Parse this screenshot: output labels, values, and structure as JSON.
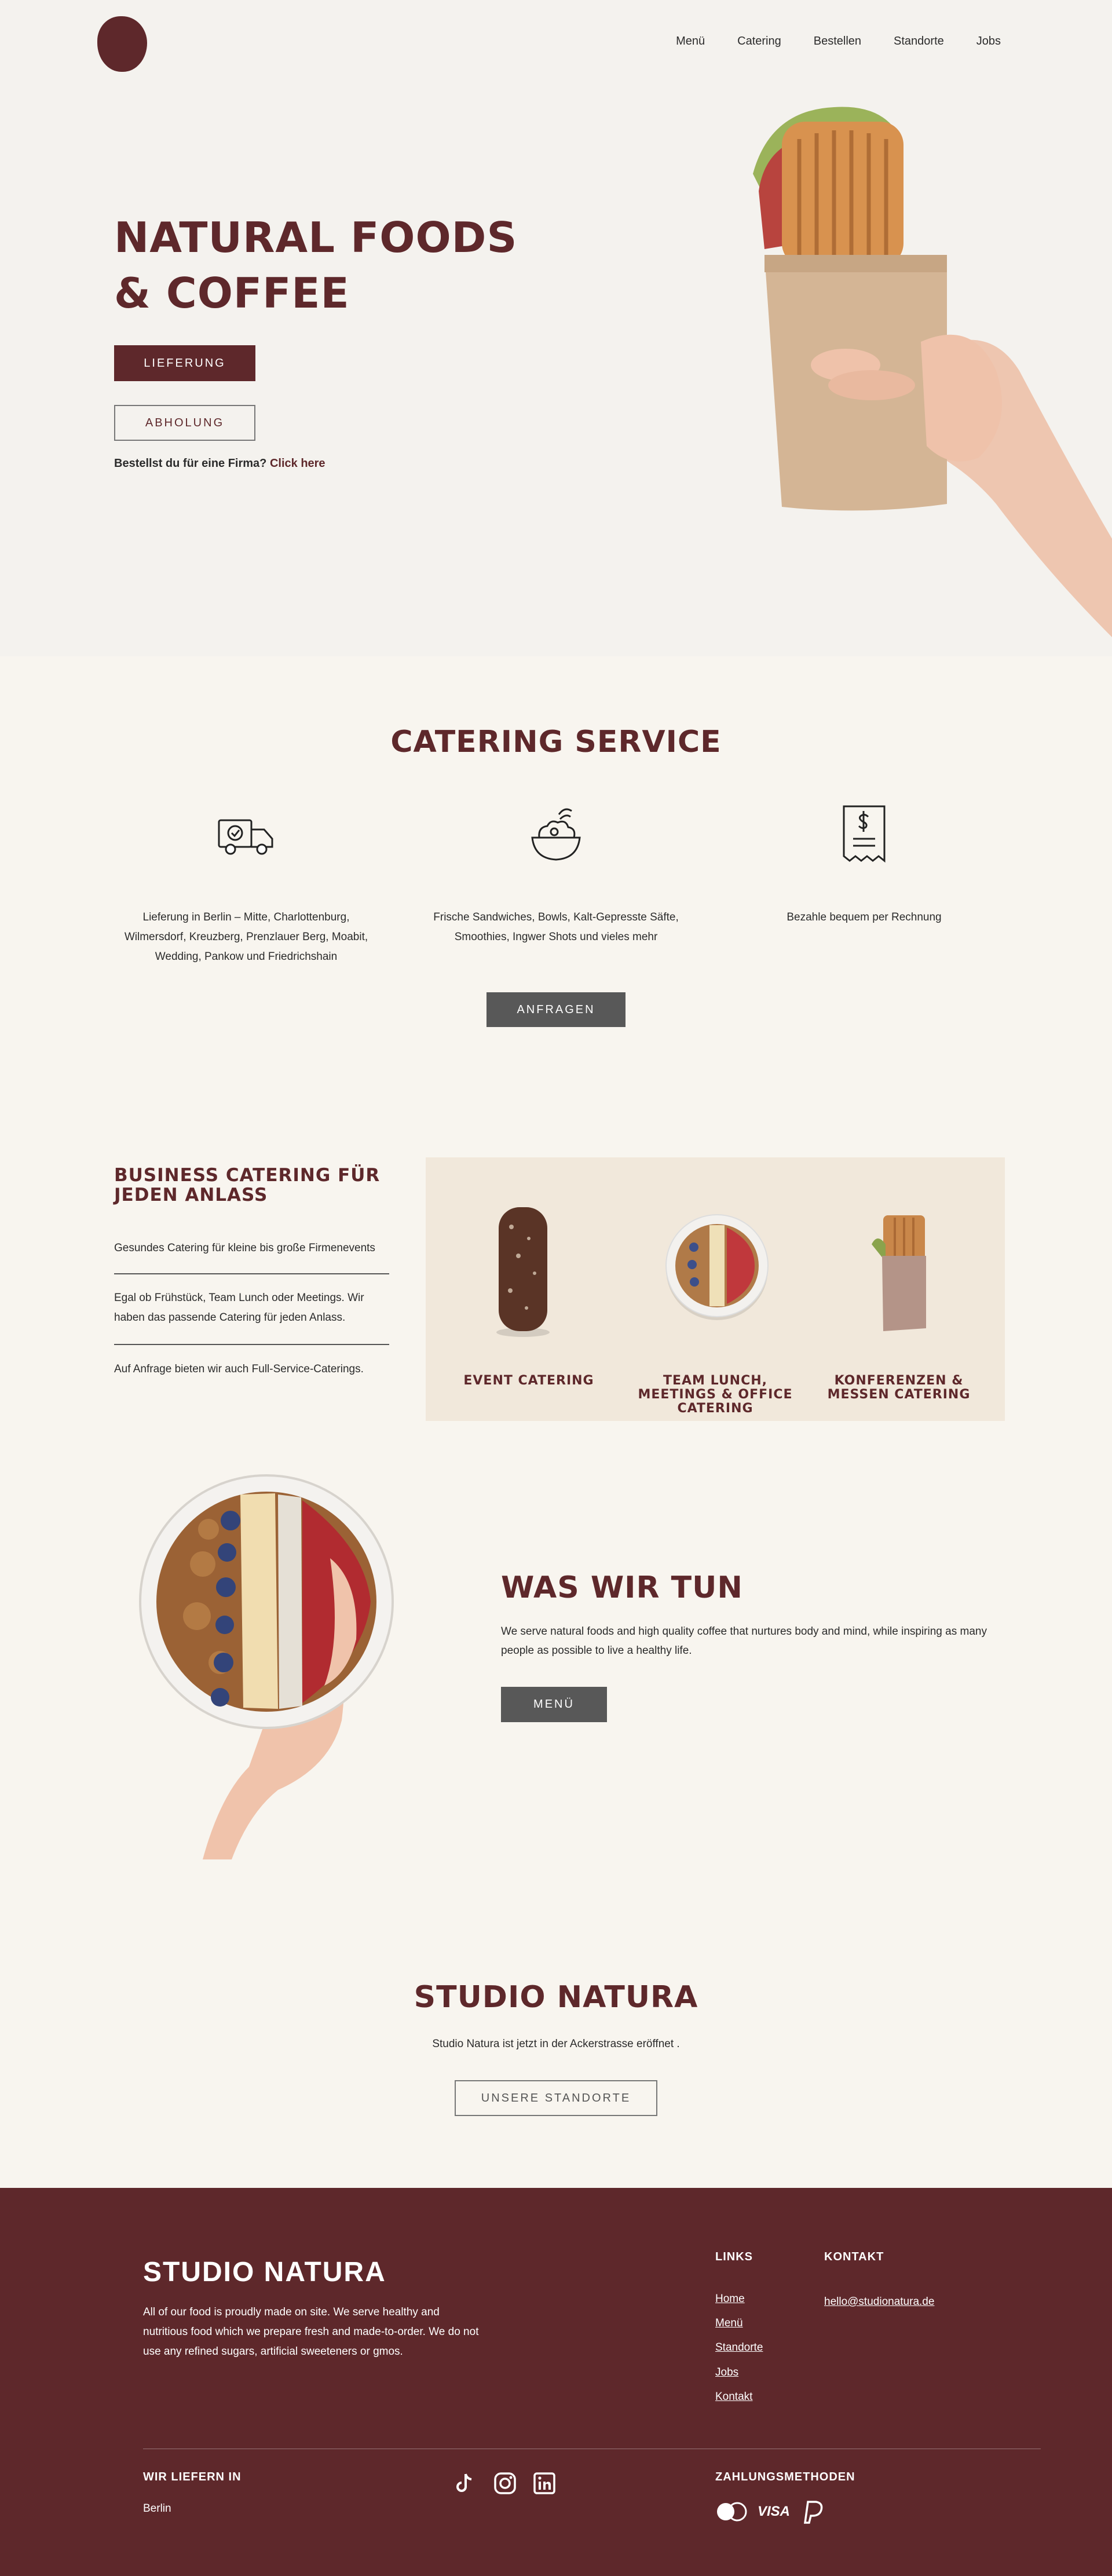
{
  "nav": {
    "items": [
      "Menü",
      "Catering",
      "Bestellen",
      "Standorte",
      "Jobs"
    ]
  },
  "hero": {
    "title": "NATURAL FOODS & COFFEE",
    "delivery_label": "LIEFERUNG",
    "pickup_label": "ABHOLUNG",
    "b2b_text": "Bestellst du für eine Firma?",
    "b2b_link": "Click here"
  },
  "catering": {
    "title": "CATERING SERVICE",
    "items": [
      {
        "icon": "delivery-truck-icon",
        "text": "Lieferung in Berlin – Mitte, Charlottenburg, Wilmersdorf, Kreuzberg, Prenzlauer Berg, Moabit, Wedding, Pankow und Friedrichshain"
      },
      {
        "icon": "salad-bowl-icon",
        "text": "Frische Sandwiches, Bowls, Kalt-Gepresste Säfte, Smoothies, Ingwer Shots und vieles mehr"
      },
      {
        "icon": "receipt-icon",
        "text": "Bezahle bequem per Rechnung"
      }
    ],
    "button": "ANFRAGEN"
  },
  "business": {
    "title": "BUSINESS CATERING FÜR JEDEN ANLASS",
    "points": [
      "Gesundes Catering für kleine bis große Firmenevents",
      "Egal ob Frühstück, Team Lunch oder Meetings. Wir haben das passende Catering für jeden Anlass.",
      "Auf Anfrage bieten wir auch Full-Service-Caterings."
    ],
    "cards": [
      {
        "label": "EVENT CATERING"
      },
      {
        "label": "TEAM LUNCH, MEETINGS & OFFICE CATERING"
      },
      {
        "label": "KONFERENZEN & MESSEN CATERING"
      }
    ]
  },
  "about": {
    "title": "WAS WIR TUN",
    "text": "We serve natural foods and high quality coffee that nurtures body and mind, while inspiring as many people as possible to live a healthy life.",
    "button": "MENÜ"
  },
  "studio": {
    "title": "STUDIO NATURA",
    "text": "Studio Natura ist jetzt in der Ackerstrasse eröffnet .",
    "button": "UNSERE STANDORTE"
  },
  "footer": {
    "logo": "STUDIO NATURA",
    "description": "All of our food is proudly made on site. We serve healthy and nutritious food which we prepare fresh and made-to-order. We do not use any refined sugars, artificial sweeteners or gmos.",
    "links_title": "LINKS",
    "links": [
      "Home",
      "Menü",
      "Standorte",
      "Jobs",
      "Kontakt"
    ],
    "contact_title": "KONTAKT",
    "email": "hello@studionatura.de",
    "delivery_title": "WIR LIEFERN IN",
    "delivery_city": "Berlin",
    "social": [
      "tiktok-icon",
      "instagram-icon",
      "linkedin-icon"
    ],
    "payment_title": "ZAHLUNGSMETHODEN",
    "payment_methods": [
      "mastercard-icon",
      "VISA",
      "paypal-icon"
    ]
  },
  "colors": {
    "brand": "#5e282b",
    "background": "#f8f5ef",
    "hero_bg": "#f4f2ee",
    "panel": "#f1e8db",
    "button_grey": "#585858"
  }
}
